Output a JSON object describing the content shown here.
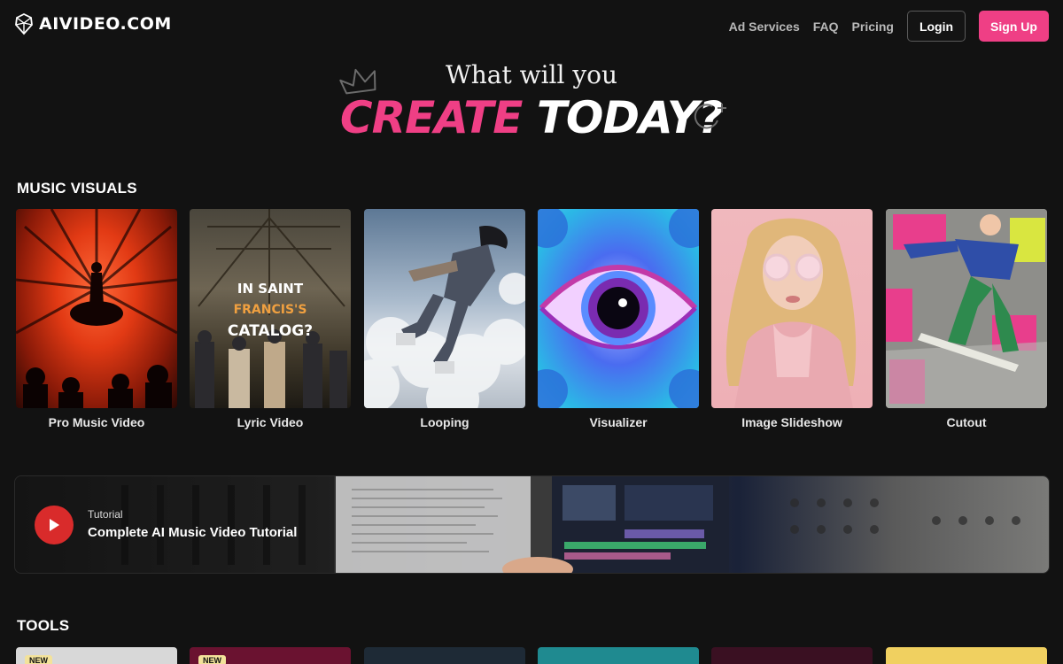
{
  "site": {
    "logo_text": "AIVIDEO.COM"
  },
  "nav": {
    "ad_services": "Ad Services",
    "faq": "FAQ",
    "pricing": "Pricing",
    "login": "Login",
    "signup": "Sign Up"
  },
  "hero": {
    "line1": "What will you",
    "create": "CREATE",
    "today": "TODAY?"
  },
  "music_visuals": {
    "title": "MUSIC VISUALS",
    "cards": [
      {
        "label": "Pro Music Video"
      },
      {
        "label": "Lyric Video",
        "overlay": [
          "IN SAINT",
          "FRANCIS'S",
          "CATALOG?"
        ]
      },
      {
        "label": "Looping"
      },
      {
        "label": "Visualizer"
      },
      {
        "label": "Image Slideshow"
      },
      {
        "label": "Cutout"
      }
    ]
  },
  "tutorial": {
    "tag": "Tutorial",
    "title": "Complete AI Music Video Tutorial"
  },
  "tools": {
    "title": "TOOLS",
    "badges": [
      "NEW",
      "NEW"
    ]
  },
  "colors": {
    "accent": "#ef3f85",
    "background": "#121212",
    "play": "#d92b2b"
  }
}
